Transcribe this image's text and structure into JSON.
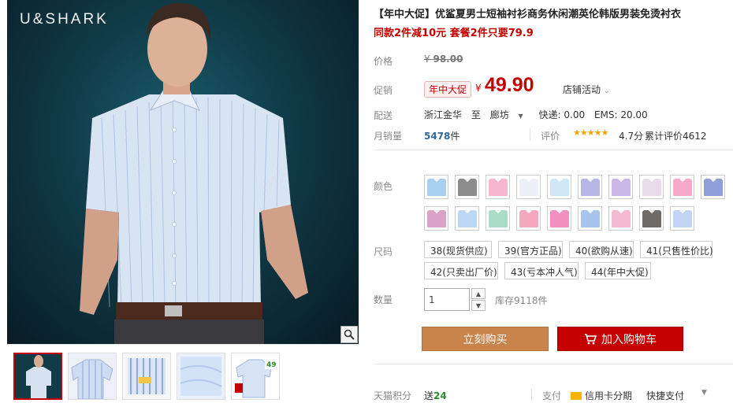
{
  "brand": "U&SHARK",
  "title": "【年中大促】优鲨夏男士短袖衬衫商务休闲潮英伦韩版男装免烫衬衣",
  "subtitle": "同款2件减10元 套餐2件只要79.9",
  "price": {
    "label": "价格",
    "currency": "¥",
    "original": "98.00"
  },
  "promo": {
    "label": "促销",
    "badge": "年中大促",
    "currency": "¥",
    "price": "49.90",
    "store_events": "店铺活动"
  },
  "shipping": {
    "label": "配送",
    "from": "浙江金华",
    "to_word": "至",
    "destination": "廊坊",
    "express": "快递: 0.00",
    "ems": "EMS: 20.00"
  },
  "sales": {
    "label": "月销量",
    "count": "5478",
    "unit": "件",
    "rating_label": "评价",
    "stars": "★★★★★",
    "score": "4.7分",
    "reviews": "累计评价4612"
  },
  "color": {
    "label": "颜色",
    "swatches": [
      "#a9cfee",
      "#8c8c8c",
      "#f4b7cf",
      "#ecf0f6",
      "#cfe7f5",
      "#b8b6e6",
      "#c9b7e8",
      "#e9dcea",
      "#f7a9c9",
      "#8f9ed6",
      "#d9a2c6",
      "#bcd7f6",
      "#a8dcc7",
      "#f5a7c0",
      "#f291c0",
      "#a7c4ec",
      "#f4b9d1",
      "#6d6a68",
      "#c2d4f4"
    ]
  },
  "size": {
    "label": "尺码",
    "options": [
      "38(现货供应)",
      "39(官方正品)",
      "40(欲购从速)",
      "41(只售性价比)",
      "42(只卖出厂价)",
      "43(亏本冲人气)",
      "44(年中大促)"
    ]
  },
  "quantity": {
    "label": "数量",
    "value": "1",
    "stock": "库存9118件"
  },
  "actions": {
    "buy_now": "立刻购买",
    "add_cart": "加入购物车"
  },
  "footer": {
    "points_label": "天猫积分",
    "points_prefix": "送",
    "points_value": "24",
    "pay_label": "支付",
    "pay_installment": "信用卡分期",
    "pay_quick": "快捷支付"
  },
  "icons": {
    "zoom": "magnifier-icon",
    "cart": "cart-icon",
    "card": "credit-card-icon"
  }
}
